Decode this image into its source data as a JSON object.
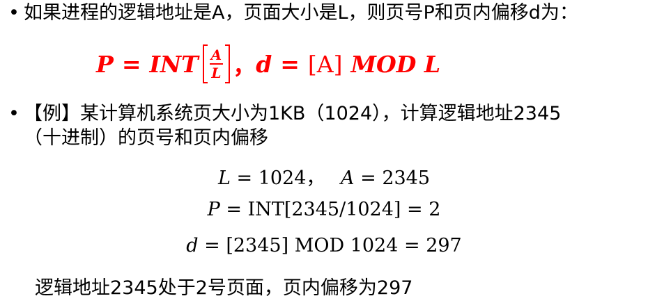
{
  "bullet_char": "•",
  "intro": {
    "text": "如果进程的逻辑地址是A，页面大小是L，则页号P和页内偏移d为："
  },
  "formula": {
    "p_var": "P",
    "eq1": "=",
    "int_fn": "INT",
    "frac_num": "A",
    "frac_den": "L",
    "comma": "，",
    "d_var": "d",
    "eq2": "=",
    "bracket_a": "[A]",
    "mod_expr": "MOD L"
  },
  "example": {
    "line1": "【例】某计算机系统页大小为1KB（1024），计算逻辑地址2345",
    "line2": "（十进制）的页号和页内偏移"
  },
  "calc": {
    "l_var": "L",
    "l_eq": "= 1024，",
    "a_var": "A",
    "a_eq": "= 2345",
    "p_var": "P",
    "p_eq": "= INT[2345/1024] = 2",
    "d_var": "d",
    "d_eq": "= [2345] MOD 1024 = 297"
  },
  "conclusion": "逻辑地址2345处于2号页面，页内偏移为297"
}
